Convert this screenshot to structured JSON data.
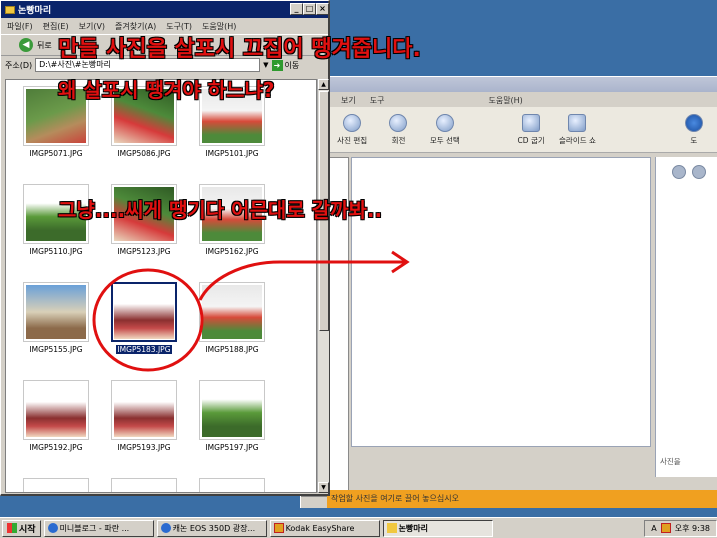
{
  "annotations": {
    "line1": "만들 사진을 살포시 끄집어 땡겨줍니다.",
    "line2": "왜 살포시 땡겨야 하느냐?",
    "line3": "그냥....씨게 땡기다 어믄대로 갈까봐.."
  },
  "explorer": {
    "title": "논빵마리",
    "menu": [
      "파일(F)",
      "편집(E)",
      "보기(V)",
      "즐겨찾기(A)",
      "도구(T)",
      "도움말(H)"
    ],
    "back_label": "뒤로",
    "address_label": "주소(D)",
    "address_value": "D:\\#사진\\#논빵마리",
    "go_label": "이동",
    "files": [
      {
        "name": "IMGP5071.JPG"
      },
      {
        "name": "IMGP5086.JPG"
      },
      {
        "name": "IMGP5101.JPG"
      },
      {
        "name": "IMGP5110.JPG"
      },
      {
        "name": "IMGP5123.JPG"
      },
      {
        "name": "IMGP5162.JPG"
      },
      {
        "name": "IMGP5155.JPG"
      },
      {
        "name": "IMGP5183.JPG",
        "selected": true
      },
      {
        "name": "IMGP5188.JPG"
      },
      {
        "name": "IMGP5192.JPG"
      },
      {
        "name": "IMGP5193.JPG"
      },
      {
        "name": "IMGP5197.JPG"
      }
    ]
  },
  "editor": {
    "menu": [
      "보기",
      "도구",
      "도움말(H)"
    ],
    "tools": [
      "사진 편집",
      "회전",
      "모두 선택",
      "CD 굽기",
      "슬라이드 쇼",
      "도"
    ],
    "side_text": "사진을",
    "status_text": "작업할 사진을 여기로 끌어 놓으십시오"
  },
  "taskbar": {
    "start": "시작",
    "tasks": [
      "미니블로그 - 파란 ...",
      "캐논 EOS 350D 광장...",
      "Kodak EasyShare",
      "논빵마리"
    ],
    "tray_lang": "A",
    "clock": "오후 9:38"
  }
}
